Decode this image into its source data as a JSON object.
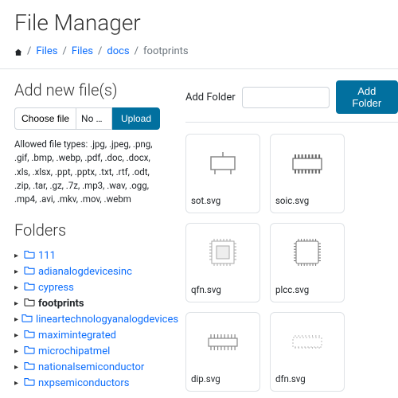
{
  "title": "File Manager",
  "breadcrumb": {
    "items": [
      "Files",
      "Files",
      "docs"
    ],
    "current": "footprints"
  },
  "sidebar": {
    "add_heading": "Add new file(s)",
    "choose_label": "Choose file",
    "nofile_label": "No fi…osen",
    "upload_label": "Upload",
    "allowed_text": "Allowed file types: .jpg, .jpeg, .png, .gif, .bmp, .webp, .pdf, .doc, .docx, .xls, .xlsx, .ppt, .pptx, .txt, .rtf, .odt, .zip, .tar, .gz, .7z, .mp3, .wav, .ogg, .mp4, .avi, .mkv, .mov, .webm",
    "folders_heading": "Folders",
    "folders": [
      {
        "name": "111",
        "active": false
      },
      {
        "name": "adianalogdevicesinc",
        "active": false
      },
      {
        "name": "cypress",
        "active": false
      },
      {
        "name": "footprints",
        "active": true
      },
      {
        "name": "lineartechnologyanalogdevices",
        "active": false
      },
      {
        "name": "maximintegrated",
        "active": false
      },
      {
        "name": "microchipatmel",
        "active": false
      },
      {
        "name": "nationalsemiconductor",
        "active": false
      },
      {
        "name": "nxpsemiconductors",
        "active": false
      }
    ]
  },
  "content": {
    "add_folder_label": "Add Folder",
    "add_folder_button": "Add Folder",
    "files": [
      {
        "name": "sot.svg"
      },
      {
        "name": "soic.svg"
      },
      {
        "name": "qfn.svg"
      },
      {
        "name": "plcc.svg"
      },
      {
        "name": "dip.svg"
      },
      {
        "name": "dfn.svg"
      }
    ]
  },
  "colors": {
    "accent": "#02709f",
    "link": "#0d6efd"
  }
}
